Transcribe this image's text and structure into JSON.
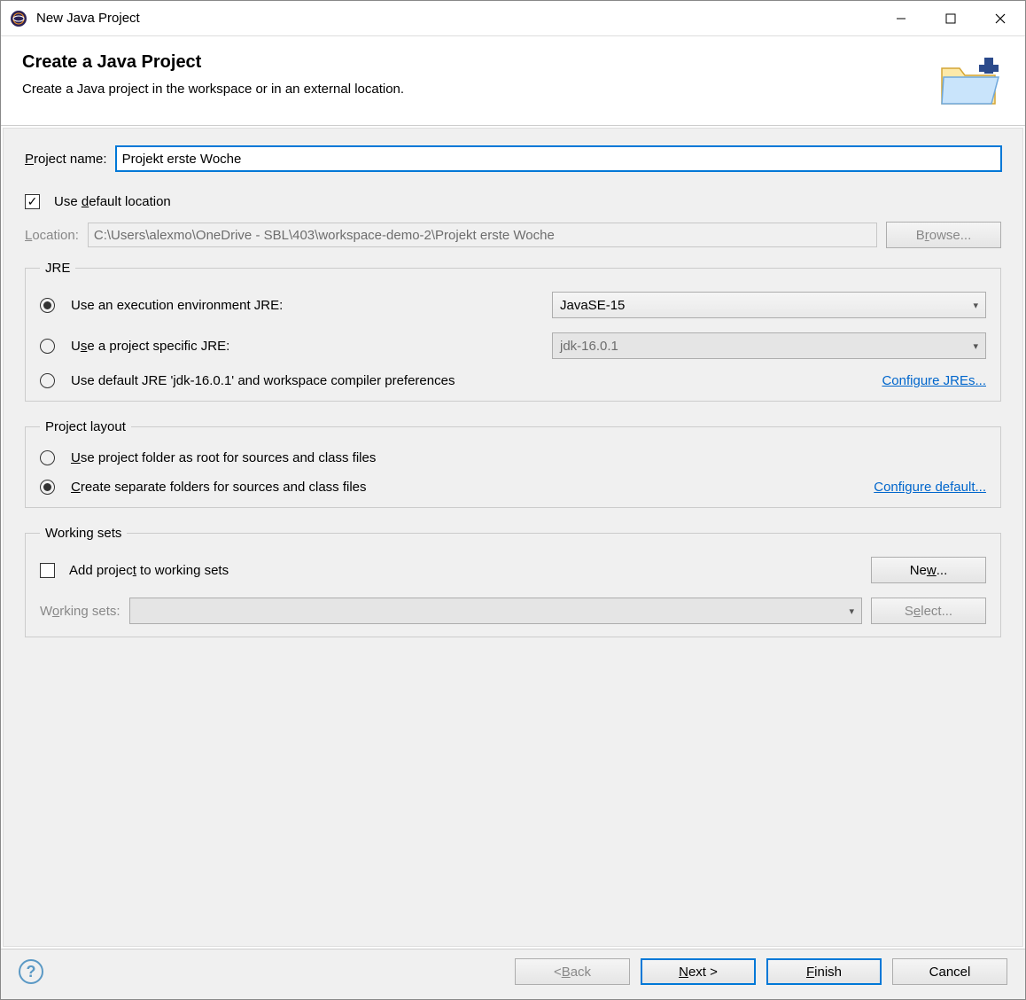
{
  "window": {
    "title": "New Java Project"
  },
  "header": {
    "title": "Create a Java Project",
    "subtitle": "Create a Java project in the workspace or in an external location."
  },
  "project": {
    "name_label": "Project name:",
    "name_value": "Projekt erste Woche",
    "use_default_label": "Use default location",
    "use_default_checked": true,
    "location_label": "Location:",
    "location_value": "C:\\Users\\alexmo\\OneDrive - SBL\\403\\workspace-demo-2\\Projekt erste Woche",
    "browse_label": "Browse..."
  },
  "jre": {
    "legend": "JRE",
    "opt_exec_env": "Use an execution environment JRE:",
    "exec_env_value": "JavaSE-15",
    "opt_project_specific": "Use a project specific JRE:",
    "project_jre_value": "jdk-16.0.1",
    "opt_default": "Use default JRE 'jdk-16.0.1' and workspace compiler preferences",
    "configure_link": "Configure JREs...",
    "selected": "exec_env"
  },
  "layout": {
    "legend": "Project layout",
    "opt_root": "Use project folder as root for sources and class files",
    "opt_separate": "Create separate folders for sources and class files",
    "configure_link": "Configure default...",
    "selected": "separate"
  },
  "working_sets": {
    "legend": "Working sets",
    "add_label": "Add project to working sets",
    "add_checked": false,
    "new_label": "New...",
    "ws_label": "Working sets:",
    "select_label": "Select..."
  },
  "buttons": {
    "back": "< Back",
    "next": "Next >",
    "finish": "Finish",
    "cancel": "Cancel"
  }
}
